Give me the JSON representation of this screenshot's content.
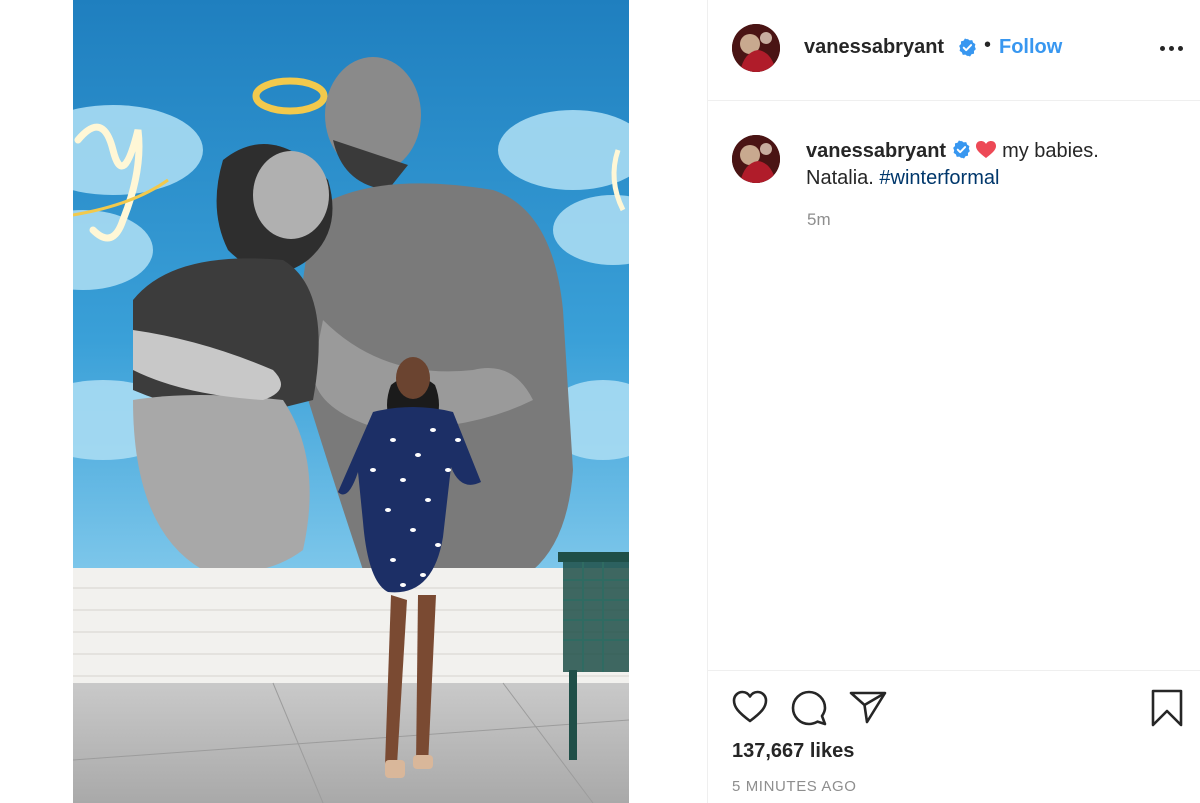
{
  "post": {
    "image_alt": "Natalia standing in front of a mural",
    "username": "vanessabryant",
    "verified": true,
    "follow_label": "Follow",
    "separator": "•",
    "caption": {
      "text": "my babies. Natalia.",
      "text_line1": "my babies.",
      "text_line2": "Natalia.",
      "emoji": "heart",
      "hashtag": "#winterformal"
    },
    "comment_time": "5m",
    "likes": "137,667 likes",
    "timestamp": "5 MINUTES AGO"
  },
  "icons": {
    "like": "heart-icon",
    "comment": "comment-icon",
    "share": "share-icon",
    "save": "bookmark-icon",
    "more": "more-options-icon",
    "verified": "verified-badge-icon"
  },
  "colors": {
    "follow": "#3897f0",
    "hashtag": "#00376b",
    "muted": "#8e8e8e",
    "verified": "#3897f0",
    "heart": "#ed4956"
  }
}
